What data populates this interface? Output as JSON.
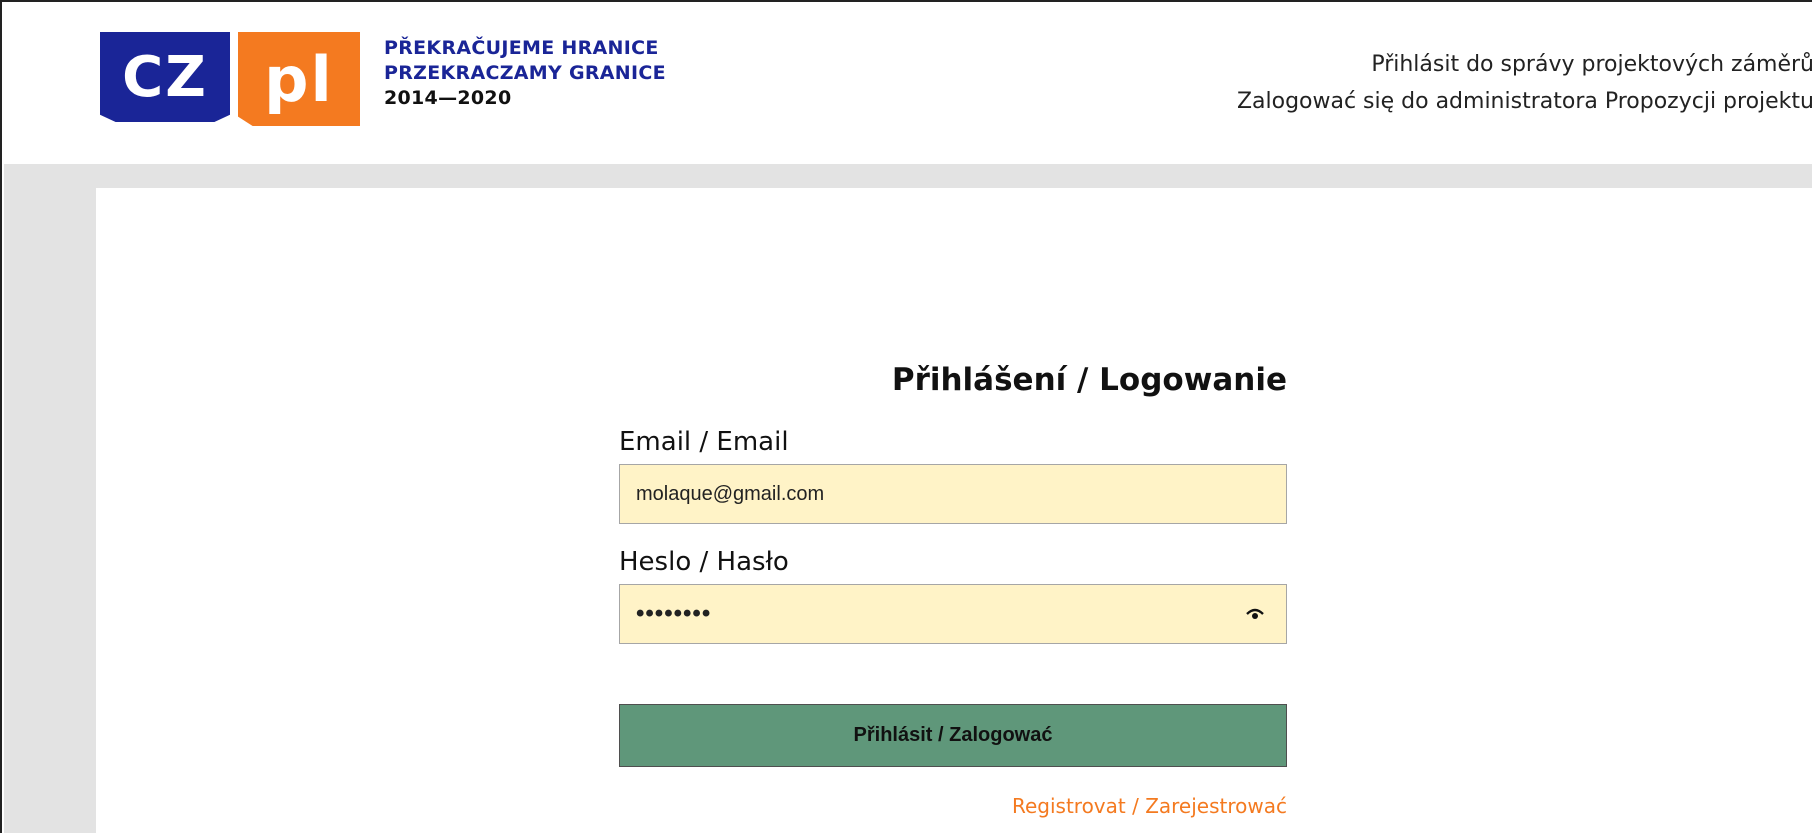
{
  "header": {
    "logo": {
      "cz": "CZ",
      "pl": "PL",
      "line1": "PŘEKRAČUJEME HRANICE",
      "line2": "PRZEKRACZAMY GRANICE",
      "years": "2014—2020"
    },
    "title_cs": "Přihlásit do správy projektových záměrů",
    "title_pl": "Zalogować się do administratora Propozycji projektu"
  },
  "login": {
    "heading": "Přihlášení / Logowanie",
    "email_label": "Email / Email",
    "email_value": "molaque@gmail.com",
    "password_label": "Heslo / Hasło",
    "password_value": "••••••••",
    "submit_label": "Přihlásit / Zalogować",
    "register_label": "Registrovat / Zarejestrować"
  },
  "colors": {
    "brand_blue": "#1a2597",
    "brand_orange": "#f47a20",
    "input_bg": "#fff3c7",
    "button_bg": "#5f977a",
    "page_bg": "#e3e3e3"
  },
  "icons": {
    "password_toggle": "eye-icon"
  }
}
